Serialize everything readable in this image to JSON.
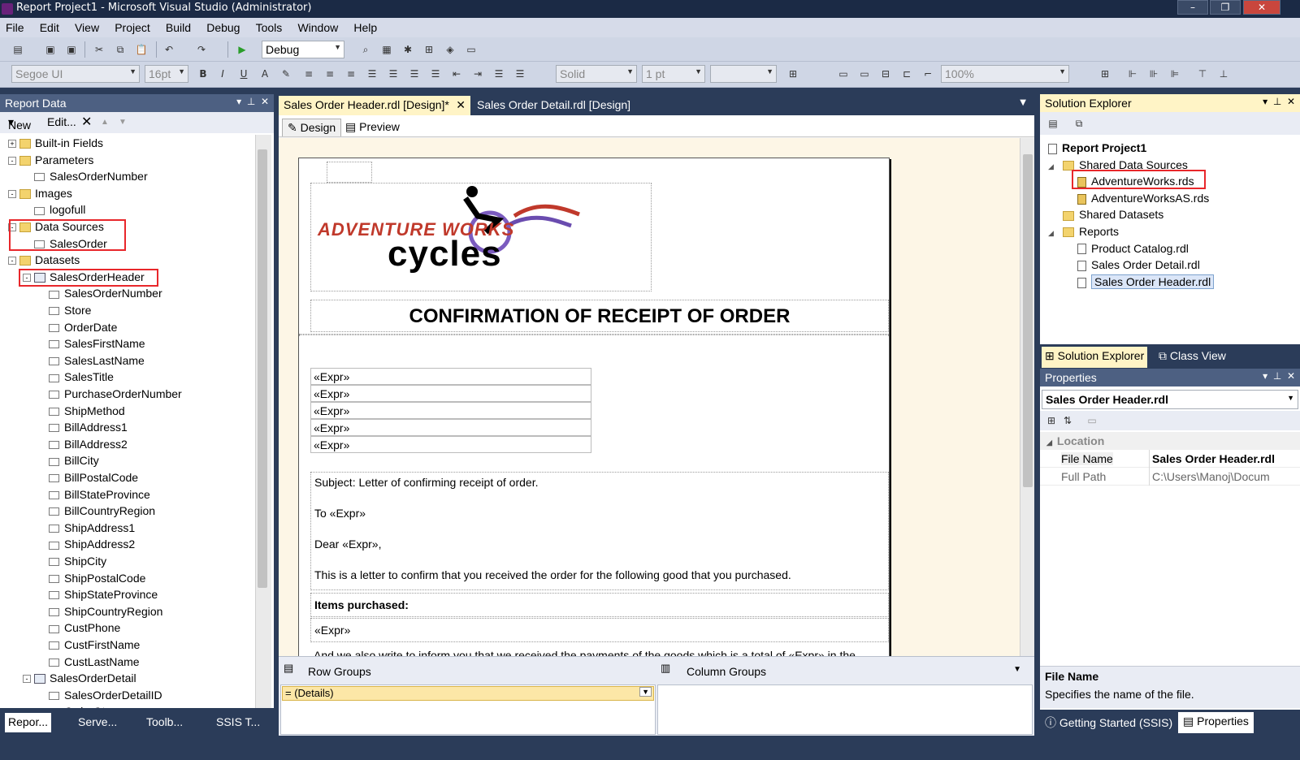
{
  "window": {
    "title": "Report Project1 - Microsoft Visual Studio (Administrator)"
  },
  "menu": [
    "File",
    "Edit",
    "View",
    "Project",
    "Build",
    "Debug",
    "Tools",
    "Window",
    "Help"
  ],
  "toolbar": {
    "config": "Debug",
    "font_name": "Segoe UI",
    "font_size": "16pt",
    "border_style": "Solid",
    "border_width": "1 pt",
    "zoom": "100%"
  },
  "report_data": {
    "title": "Report Data",
    "tools": {
      "new": "New",
      "edit": "Edit...",
      "delete_icon": "close-icon"
    },
    "tree": [
      {
        "label": "Built-in Fields",
        "level": 0,
        "kind": "folder",
        "expander": "+"
      },
      {
        "label": "Parameters",
        "level": 0,
        "kind": "folder",
        "expander": "-"
      },
      {
        "label": "SalesOrderNumber",
        "level": 1,
        "kind": "param"
      },
      {
        "label": "Images",
        "level": 0,
        "kind": "folder",
        "expander": "-"
      },
      {
        "label": "logofull",
        "level": 1,
        "kind": "image"
      },
      {
        "label": "Data Sources",
        "level": 0,
        "kind": "folder",
        "expander": "-"
      },
      {
        "label": "SalesOrder",
        "level": 1,
        "kind": "datasource"
      },
      {
        "label": "Datasets",
        "level": 0,
        "kind": "folder",
        "expander": "-"
      },
      {
        "label": "SalesOrderHeader",
        "level": 1,
        "kind": "dataset",
        "expander": "-"
      },
      {
        "label": "SalesOrderNumber",
        "level": 2,
        "kind": "field"
      },
      {
        "label": "Store",
        "level": 2,
        "kind": "field"
      },
      {
        "label": "OrderDate",
        "level": 2,
        "kind": "field"
      },
      {
        "label": "SalesFirstName",
        "level": 2,
        "kind": "field"
      },
      {
        "label": "SalesLastName",
        "level": 2,
        "kind": "field"
      },
      {
        "label": "SalesTitle",
        "level": 2,
        "kind": "field"
      },
      {
        "label": "PurchaseOrderNumber",
        "level": 2,
        "kind": "field"
      },
      {
        "label": "ShipMethod",
        "level": 2,
        "kind": "field"
      },
      {
        "label": "BillAddress1",
        "level": 2,
        "kind": "field"
      },
      {
        "label": "BillAddress2",
        "level": 2,
        "kind": "field"
      },
      {
        "label": "BillCity",
        "level": 2,
        "kind": "field"
      },
      {
        "label": "BillPostalCode",
        "level": 2,
        "kind": "field"
      },
      {
        "label": "BillStateProvince",
        "level": 2,
        "kind": "field"
      },
      {
        "label": "BillCountryRegion",
        "level": 2,
        "kind": "field"
      },
      {
        "label": "ShipAddress1",
        "level": 2,
        "kind": "field"
      },
      {
        "label": "ShipAddress2",
        "level": 2,
        "kind": "field"
      },
      {
        "label": "ShipCity",
        "level": 2,
        "kind": "field"
      },
      {
        "label": "ShipPostalCode",
        "level": 2,
        "kind": "field"
      },
      {
        "label": "ShipStateProvince",
        "level": 2,
        "kind": "field"
      },
      {
        "label": "ShipCountryRegion",
        "level": 2,
        "kind": "field"
      },
      {
        "label": "CustPhone",
        "level": 2,
        "kind": "field"
      },
      {
        "label": "CustFirstName",
        "level": 2,
        "kind": "field"
      },
      {
        "label": "CustLastName",
        "level": 2,
        "kind": "field"
      },
      {
        "label": "SalesOrderDetail",
        "level": 1,
        "kind": "dataset",
        "expander": "-"
      },
      {
        "label": "SalesOrderDetailID",
        "level": 2,
        "kind": "field"
      },
      {
        "label": "OrderQty",
        "level": 2,
        "kind": "field"
      }
    ],
    "bottom_tabs": [
      "Repor...",
      "Serve...",
      "Toolb...",
      "SSIS T..."
    ]
  },
  "documents": {
    "tabs": [
      "Sales Order Header.rdl [Design]*",
      "Sales Order Detail.rdl [Design]"
    ],
    "view_tabs": [
      "Design",
      "Preview"
    ]
  },
  "report": {
    "logo_text_1": "ADVENTURE WORKS",
    "logo_text_2": "cycles",
    "heading": "CONFIRMATION OF RECEIPT OF ORDER",
    "expr_rows": [
      "«Expr»",
      "«Expr»",
      "«Expr»",
      "«Expr»",
      "«Expr»"
    ],
    "subject": "Subject: Letter of confirming receipt of order.",
    "to": "To «Expr»",
    "dear": "Dear «Expr»,",
    "body": "This is a letter to confirm that you received the order for the following good that you purchased.",
    "items_label": "Items purchased:",
    "items_expr": "«Expr»",
    "cutoff_text": "And we also write to inform you that we received the payments of the goods which is a total of «Expr» in the"
  },
  "groups": {
    "row_groups": "Row Groups",
    "column_groups": "Column Groups",
    "details": "= (Details)"
  },
  "solution_explorer": {
    "title": "Solution Explorer",
    "items": [
      {
        "label": "Report Project1",
        "level": 0,
        "kind": "project"
      },
      {
        "label": "Shared Data Sources",
        "level": 1,
        "kind": "folder",
        "expander": "◢"
      },
      {
        "label": "AdventureWorks.rds",
        "level": 2,
        "kind": "rds"
      },
      {
        "label": "AdventureWorksAS.rds",
        "level": 2,
        "kind": "rds"
      },
      {
        "label": "Shared Datasets",
        "level": 1,
        "kind": "folder"
      },
      {
        "label": "Reports",
        "level": 1,
        "kind": "folder",
        "expander": "◢"
      },
      {
        "label": "Product Catalog.rdl",
        "level": 2,
        "kind": "rdl"
      },
      {
        "label": "Sales Order Detail.rdl",
        "level": 2,
        "kind": "rdl"
      },
      {
        "label": "Sales Order Header.rdl",
        "level": 2,
        "kind": "rdl"
      }
    ],
    "tabs": [
      "Solution Explorer",
      "Class View"
    ]
  },
  "properties": {
    "title": "Properties",
    "object": "Sales Order Header.rdl",
    "category": "Location",
    "rows": [
      {
        "name": "File Name",
        "value": "Sales Order Header.rdl"
      },
      {
        "name": "Full Path",
        "value": "C:\\Users\\Manoj\\Docum"
      }
    ],
    "desc_title": "File Name",
    "desc_text": "Specifies the name of the file.",
    "tabs": [
      "Getting Started (SSIS)",
      "Properties"
    ]
  },
  "colors": {
    "accent": "#fff4c6",
    "highlight_box": "#e8272b",
    "chrome": "#2b3c59"
  }
}
